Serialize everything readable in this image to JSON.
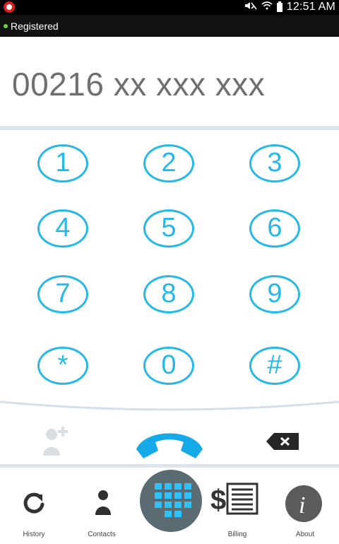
{
  "status_bar": {
    "time": "12:51 AM",
    "icons": [
      "mute-icon",
      "wifi-icon",
      "battery-icon"
    ]
  },
  "registration": {
    "status_text": "Registered"
  },
  "display": {
    "number": "00216 xx xxx xxx"
  },
  "keypad": {
    "keys": [
      {
        "label": "1"
      },
      {
        "label": "2"
      },
      {
        "label": "3"
      },
      {
        "label": "4"
      },
      {
        "label": "5"
      },
      {
        "label": "6"
      },
      {
        "label": "7"
      },
      {
        "label": "8"
      },
      {
        "label": "9"
      },
      {
        "label": "*"
      },
      {
        "label": "0"
      },
      {
        "label": "#"
      }
    ]
  },
  "actions": {
    "add_contact_icon": "add-contact-icon",
    "call_icon": "phone-icon",
    "backspace_icon": "backspace-icon"
  },
  "bottom_nav": {
    "items": [
      {
        "label": "History",
        "icon": "refresh-icon"
      },
      {
        "label": "Contacts",
        "icon": "person-icon"
      },
      {
        "label": "",
        "icon": "dialpad-icon"
      },
      {
        "label": "Billing",
        "icon": "billing-icon"
      },
      {
        "label": "About",
        "icon": "info-icon"
      }
    ]
  },
  "colors": {
    "accent": "#27b8e6",
    "call_button": "#16a9e8",
    "nav_dark": "#5a6c72"
  }
}
